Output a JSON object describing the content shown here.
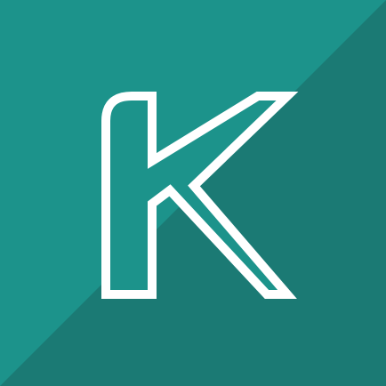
{
  "icon": {
    "letter": "K",
    "name": "letter-k-logo-icon",
    "colors": {
      "background_light": "#1c938b",
      "background_dark": "#1b7a74",
      "letter_fill": "#1c938b",
      "letter_outline": "#ffffff"
    }
  }
}
